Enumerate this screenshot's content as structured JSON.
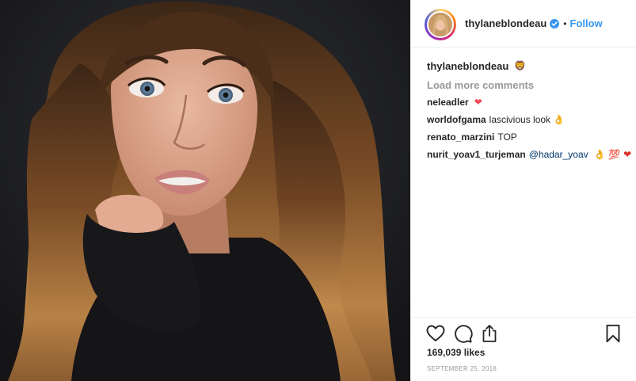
{
  "post": {
    "author": {
      "username": "thylaneblondeau",
      "verified_icon": "verified-badge-icon",
      "separator": "•",
      "follow_label": "Follow"
    },
    "photo": {
      "description_icon": "portrait-photo"
    },
    "caption": {
      "username": "thylaneblondeau",
      "emoji": "🦁"
    },
    "load_more_label": "Load more comments",
    "comments": [
      {
        "username": "neleadler",
        "text": "",
        "mention": "",
        "emoji": "❤"
      },
      {
        "username": "worldofgama",
        "text": "lascivious look",
        "mention": "",
        "emoji": "👌"
      },
      {
        "username": "renato_marzini",
        "text": "TOP",
        "mention": "",
        "emoji": ""
      },
      {
        "username": "nurit_yoav1_turjeman",
        "text": "",
        "mention": "@hadar_yoav",
        "emoji": "👌 💯 ❤"
      }
    ],
    "actions": {
      "like_icon": "heart-icon",
      "comment_icon": "comment-icon",
      "share_icon": "share-icon",
      "save_icon": "bookmark-icon"
    },
    "likes": "169,039 likes",
    "date": "SEPTEMBER 25, 2018"
  },
  "colors": {
    "link_blue": "#3897f0",
    "mention_blue": "#003569",
    "heart_red": "#ed4956",
    "muted": "#999999"
  }
}
